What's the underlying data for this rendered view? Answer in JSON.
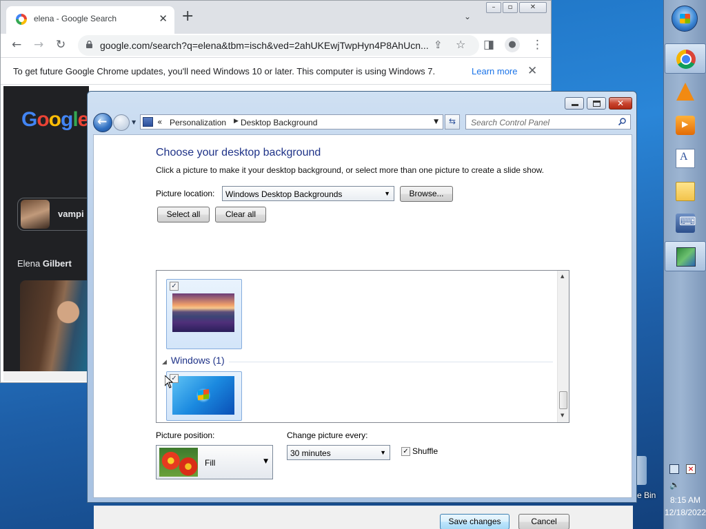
{
  "chrome": {
    "tab_title": "elena - Google Search",
    "url": "google.com/search?q=elena&tbm=isch&ved=2ahUKEwjTwpHyn4P8AhUcn...",
    "infobar_text": "To get future Google Chrome updates, you'll need Windows 10 or later. This computer is using Windows 7.",
    "infobar_link": "Learn more",
    "page": {
      "logo_text": "Google",
      "chip_label": "vampi",
      "entity_title_first": "Elena",
      "entity_title_last": "Gilbert"
    }
  },
  "explorer": {
    "breadcrumb_prefix": "«",
    "breadcrumb": [
      "Personalization",
      "Desktop Background"
    ],
    "search_placeholder": "Search Control Panel",
    "title": "Choose your desktop background",
    "description": "Click a picture to make it your desktop background, or select more than one picture to create a slide show.",
    "picture_location_label": "Picture location:",
    "picture_location_value": "Windows Desktop Backgrounds",
    "browse_label": "Browse...",
    "select_all_label": "Select all",
    "clear_all_label": "Clear all",
    "group_header": "Windows (1)",
    "thumbnails": [
      {
        "name": "lake-sunset-wallpaper",
        "checked": true
      },
      {
        "name": "windows-7-wallpaper",
        "checked": true
      }
    ],
    "picture_position_label": "Picture position:",
    "picture_position_value": "Fill",
    "change_every_label": "Change picture every:",
    "change_every_value": "30 minutes",
    "shuffle_label": "Shuffle",
    "shuffle_checked": true,
    "save_label": "Save changes",
    "cancel_label": "Cancel"
  },
  "taskbar": {
    "icons": [
      "start-orb",
      "chrome-icon",
      "vlc-icon",
      "media-player-icon",
      "wordpad-icon",
      "folder-icon",
      "on-screen-keyboard-icon",
      "personalization-icon"
    ],
    "clock_time": "8:15 AM",
    "clock_date": "12/18/2022"
  },
  "desktop": {
    "recycle_bin_label": "e Bin"
  }
}
